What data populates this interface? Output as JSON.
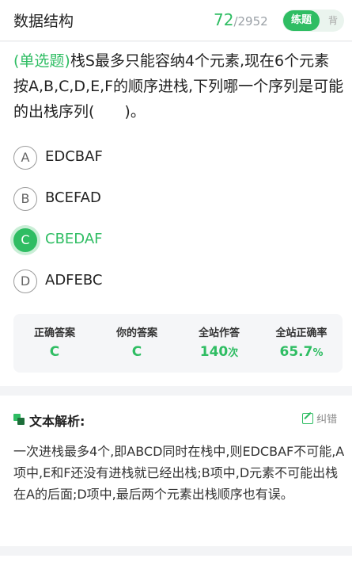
{
  "header": {
    "title": "数据结构",
    "current": "72",
    "separator": "/",
    "total": "2952",
    "mode_active": "练题",
    "mode_inactive": "背"
  },
  "question": {
    "type": "(单选题)",
    "text": "栈S最多只能容纳4个元素,现在6个元素按A,B,C,D,E,F的顺序进栈,下列哪一个序列是可能的出栈序列(　　)。",
    "options": [
      {
        "letter": "A",
        "text": "EDCBAF"
      },
      {
        "letter": "B",
        "text": "BCEFAD"
      },
      {
        "letter": "C",
        "text": "CBEDAF"
      },
      {
        "letter": "D",
        "text": "ADFEBC"
      }
    ],
    "selected": "C"
  },
  "stats": {
    "correct_label": "正确答案",
    "correct_value": "C",
    "yours_label": "你的答案",
    "yours_value": "C",
    "count_label": "全站作答",
    "count_value": "140",
    "count_unit": "次",
    "rate_label": "全站正确率",
    "rate_value": "65.7",
    "rate_unit": "%"
  },
  "analysis": {
    "title": "文本解析:",
    "report_label": "纠错",
    "text": "一次进栈最多4个,即ABCD同时在栈中,则EDCBAF不可能,A项中,E和F还没有进栈就已经出栈;B项中,D元素不可能出栈在A的后面;D项中,最后两个元素出栈顺序也有误。"
  },
  "colors": {
    "accent": "#2fbd63",
    "accent_light": "#c9eed6",
    "muted": "#9aa0a6"
  }
}
